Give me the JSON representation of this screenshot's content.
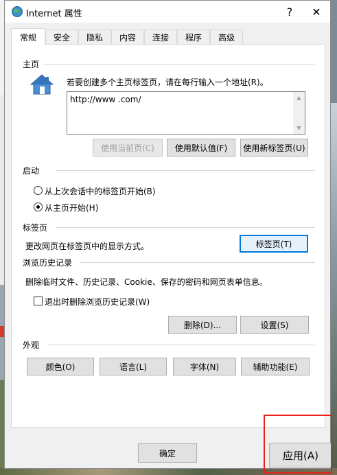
{
  "window": {
    "title": "Internet 属性",
    "help_label": "?",
    "close_label": "✕"
  },
  "tabs": [
    {
      "label": "常规",
      "active": true
    },
    {
      "label": "安全"
    },
    {
      "label": "隐私"
    },
    {
      "label": "内容"
    },
    {
      "label": "连接"
    },
    {
      "label": "程序"
    },
    {
      "label": "高级"
    }
  ],
  "homepage": {
    "section_label": "主页",
    "instruction": "若要创建多个主页标签页，请在每行输入一个地址(R)。",
    "url_value": "http://www              .com/",
    "use_current_label": "使用当前页(C)",
    "use_default_label": "使用默认值(F)",
    "use_new_tab_label": "使用新标签页(U)"
  },
  "startup": {
    "section_label": "启动",
    "option_last_session": "从上次会话中的标签页开始(B)",
    "option_homepage": "从主页开始(H)"
  },
  "tabs_section": {
    "section_label": "标签页",
    "description": "更改网页在标签页中的显示方式。",
    "button_label": "标签页(T)"
  },
  "history": {
    "section_label": "浏览历史记录",
    "description": "删除临时文件、历史记录、Cookie、保存的密码和网页表单信息。",
    "checkbox_label": "退出时删除浏览历史记录(W)",
    "delete_label": "删除(D)...",
    "settings_label": "设置(S)"
  },
  "appearance": {
    "section_label": "外观",
    "colors_label": "颜色(O)",
    "languages_label": "语言(L)",
    "fonts_label": "字体(N)",
    "accessibility_label": "辅助功能(E)"
  },
  "footer": {
    "ok_label": "确定",
    "apply_label": "应用(A)"
  },
  "colors": {
    "highlight": "#e8221b",
    "focus": "#0078d7",
    "globe_icon": "globe-icon",
    "house_icon": "house-icon"
  }
}
